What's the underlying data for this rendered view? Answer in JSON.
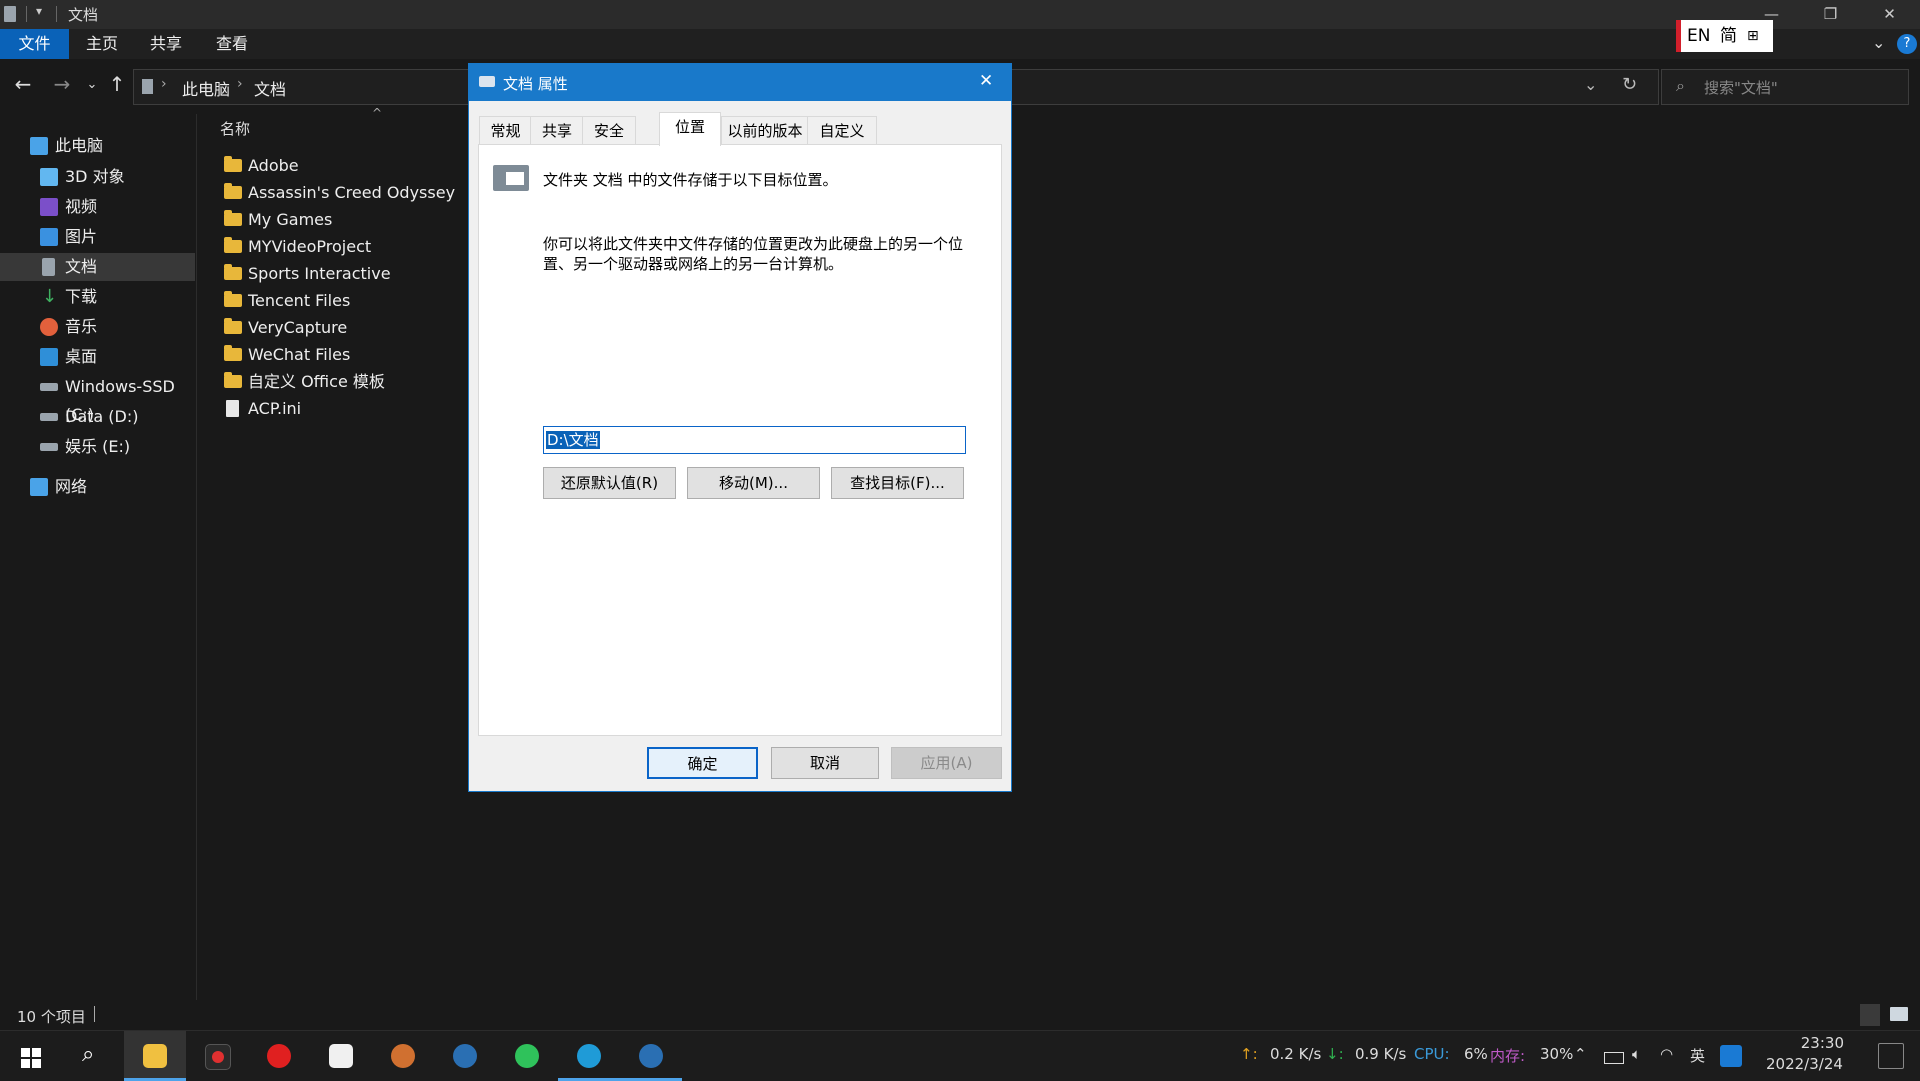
{
  "window": {
    "title": "文档",
    "minimize_glyph": "—",
    "restore_glyph": "❐",
    "close_glyph": "✕"
  },
  "ribbon": {
    "tabs": [
      "文件",
      "主页",
      "共享",
      "查看"
    ]
  },
  "address": {
    "path": [
      "此电脑",
      "文档"
    ],
    "search_placeholder": "搜索\"文档\""
  },
  "sidebar": {
    "items": [
      {
        "label": "此电脑",
        "icon": "computer-icon",
        "color": "#4aa3e8"
      },
      {
        "label": "3D 对象",
        "icon": "3d-objects-icon",
        "color": "#62b7f0"
      },
      {
        "label": "视频",
        "icon": "video-icon",
        "color": "#7b4fc9"
      },
      {
        "label": "图片",
        "icon": "pictures-icon",
        "color": "#3a91e0"
      },
      {
        "label": "文档",
        "icon": "documents-icon",
        "color": "#9aa4ad"
      },
      {
        "label": "下载",
        "icon": "download-icon",
        "color": "#3fb060"
      },
      {
        "label": "音乐",
        "icon": "music-icon",
        "color": "#e2603c"
      },
      {
        "label": "桌面",
        "icon": "desktop-icon",
        "color": "#2f8fd8"
      },
      {
        "label": "Windows-SSD (C:)",
        "icon": "drive-icon",
        "color": "#9aa4ad"
      },
      {
        "label": "Data (D:)",
        "icon": "drive-icon",
        "color": "#9aa4ad"
      },
      {
        "label": "娱乐 (E:)",
        "icon": "drive-icon",
        "color": "#9aa4ad"
      },
      {
        "label": "网络",
        "icon": "network-icon",
        "color": "#4aa3e8"
      }
    ]
  },
  "filelist": {
    "column_name": "名称",
    "files": [
      {
        "name": "Adobe",
        "type": "folder"
      },
      {
        "name": "Assassin's Creed Odyssey",
        "type": "folder"
      },
      {
        "name": "My Games",
        "type": "folder"
      },
      {
        "name": "MYVideoProject",
        "type": "folder"
      },
      {
        "name": "Sports Interactive",
        "type": "folder"
      },
      {
        "name": "Tencent Files",
        "type": "folder"
      },
      {
        "name": "VeryCapture",
        "type": "folder"
      },
      {
        "name": "WeChat Files",
        "type": "folder"
      },
      {
        "name": "自定义 Office 模板",
        "type": "folder"
      },
      {
        "name": "ACP.ini",
        "type": "file"
      }
    ]
  },
  "status": {
    "count": "10 个项目"
  },
  "ime": {
    "lang": "EN",
    "mode": "简"
  },
  "dialog": {
    "title": "文档 属性",
    "tabs": [
      "常规",
      "共享",
      "安全",
      "位置",
      "以前的版本",
      "自定义"
    ],
    "active_tab": "位置",
    "heading": "文件夹 文档 中的文件存储于以下目标位置。",
    "description": "你可以将此文件夹中文件存储的位置更改为此硬盘上的另一个位置、另一个驱动器或网络上的另一台计算机。",
    "path_value": "D:\\文档",
    "restore_button": "还原默认值(R)",
    "move_button": "移动(M)...",
    "find_button": "查找目标(F)...",
    "ok_button": "确定",
    "cancel_button": "取消",
    "apply_button": "应用(A)"
  },
  "taskbar": {
    "apps": [
      {
        "name": "start-icon",
        "color": "#ffffff"
      },
      {
        "name": "search-icon",
        "color": "#ffffff"
      },
      {
        "name": "file-explorer-icon",
        "color": "#f0c040"
      },
      {
        "name": "recorder-icon",
        "color": "#e03030"
      },
      {
        "name": "netease-music-icon",
        "color": "#e02020"
      },
      {
        "name": "store-icon",
        "color": "#f0f0f0"
      },
      {
        "name": "media-player-icon",
        "color": "#d07030"
      },
      {
        "name": "steam-icon",
        "color": "#2a6fb3"
      },
      {
        "name": "wechat-icon",
        "color": "#2fc25b"
      },
      {
        "name": "edge-icon",
        "color": "#1f9bd7"
      },
      {
        "name": "steam-icon",
        "color": "#2a6fb3"
      }
    ],
    "net_up_glyph": "↑:",
    "net_up": "0.2 K/s",
    "net_down_glyph": "↓:",
    "net_down": "0.9 K/s",
    "cpu_label": "CPU:",
    "cpu_value": "6%",
    "mem_label": "内存:",
    "mem_value": "30%",
    "ime_lang": "英",
    "time": "23:30",
    "date": "2022/3/24"
  },
  "colors": {
    "accent": "#0a62b8",
    "dialog_title": "#1979ca",
    "folder": "#e8b73a"
  }
}
